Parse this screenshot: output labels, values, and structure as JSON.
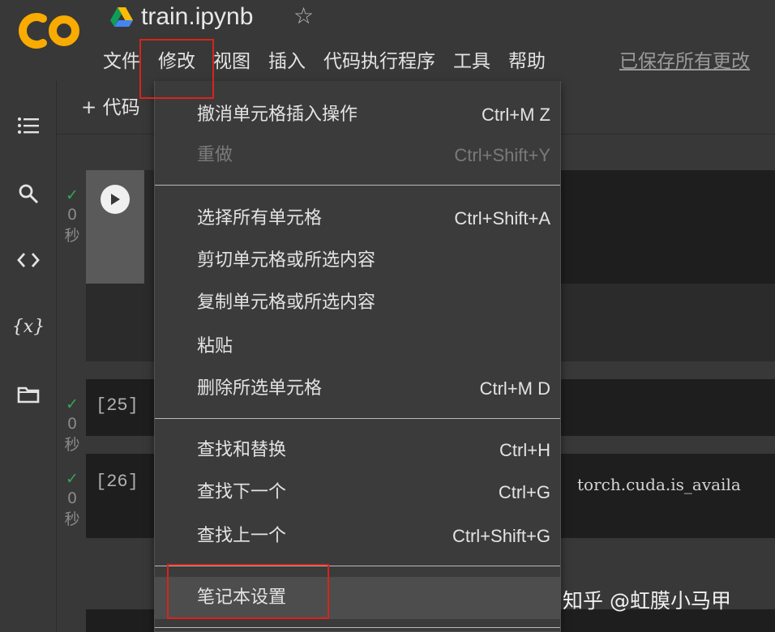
{
  "header": {
    "title": "train.ipynb",
    "star": "☆",
    "logo_text": "CO",
    "menu": [
      "文件",
      "修改",
      "视图",
      "插入",
      "代码执行程序",
      "工具",
      "帮助"
    ],
    "saved_status": "已保存所有更改"
  },
  "toolbar": {
    "add_code": "+ 代码"
  },
  "sidebar": {
    "icons": [
      "toc-icon",
      "search-icon",
      "code-snippets-icon",
      "variables-icon",
      "folder-icon"
    ],
    "variables_glyph": "{x}"
  },
  "cells": [
    {
      "status_time": "0",
      "status_unit": "秒",
      "exec_count": ""
    },
    {
      "status_time": "0",
      "status_unit": "秒",
      "exec_count": "[25]"
    },
    {
      "status_time": "0",
      "status_unit": "秒",
      "exec_count": "[26]",
      "code": "torch.cuda.is_availa"
    }
  ],
  "edit_menu": {
    "items": [
      {
        "label": "撤消单元格插入操作",
        "shortcut": "Ctrl+M Z",
        "disabled": false
      },
      {
        "label": "重做",
        "shortcut": "Ctrl+Shift+Y",
        "disabled": true
      },
      {
        "label": "选择所有单元格",
        "shortcut": "Ctrl+Shift+A",
        "disabled": false
      },
      {
        "label": "剪切单元格或所选内容",
        "shortcut": "",
        "disabled": false
      },
      {
        "label": "复制单元格或所选内容",
        "shortcut": "",
        "disabled": false
      },
      {
        "label": "粘贴",
        "shortcut": "",
        "disabled": false
      },
      {
        "label": "删除所选单元格",
        "shortcut": "Ctrl+M D",
        "disabled": false
      },
      {
        "label": "查找和替换",
        "shortcut": "Ctrl+H",
        "disabled": false
      },
      {
        "label": "查找下一个",
        "shortcut": "Ctrl+G",
        "disabled": false
      },
      {
        "label": "查找上一个",
        "shortcut": "Ctrl+Shift+G",
        "disabled": false
      },
      {
        "label": "笔记本设置",
        "shortcut": "",
        "disabled": false
      }
    ]
  },
  "watermark": "知乎 @虹膜小马甲",
  "colors": {
    "logo_orange": "#f9ab00",
    "check_green": "#34a853",
    "highlight_red": "#d9231c"
  }
}
